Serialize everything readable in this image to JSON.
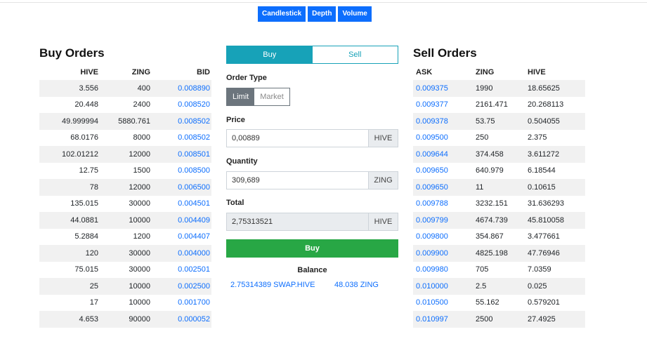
{
  "chart_tabs": [
    "Candlestick",
    "Depth",
    "Volume"
  ],
  "buy_orders": {
    "title": "Buy Orders",
    "columns": [
      "HIVE",
      "ZING",
      "BID"
    ],
    "rows": [
      [
        "3.556",
        "400",
        "0.008890"
      ],
      [
        "20.448",
        "2400",
        "0.008520"
      ],
      [
        "49.999994",
        "5880.761",
        "0.008502"
      ],
      [
        "68.0176",
        "8000",
        "0.008502"
      ],
      [
        "102.01212",
        "12000",
        "0.008501"
      ],
      [
        "12.75",
        "1500",
        "0.008500"
      ],
      [
        "78",
        "12000",
        "0.006500"
      ],
      [
        "135.015",
        "30000",
        "0.004501"
      ],
      [
        "44.0881",
        "10000",
        "0.004409"
      ],
      [
        "5.2884",
        "1200",
        "0.004407"
      ],
      [
        "120",
        "30000",
        "0.004000"
      ],
      [
        "75.015",
        "30000",
        "0.002501"
      ],
      [
        "25",
        "10000",
        "0.002500"
      ],
      [
        "17",
        "10000",
        "0.001700"
      ],
      [
        "4.653",
        "90000",
        "0.000052"
      ]
    ]
  },
  "sell_orders": {
    "title": "Sell Orders",
    "columns": [
      "ASK",
      "ZING",
      "HIVE"
    ],
    "rows": [
      [
        "0.009375",
        "1990",
        "18.65625"
      ],
      [
        "0.009377",
        "2161.471",
        "20.268113"
      ],
      [
        "0.009378",
        "53.75",
        "0.504055"
      ],
      [
        "0.009500",
        "250",
        "2.375"
      ],
      [
        "0.009644",
        "374.458",
        "3.611272"
      ],
      [
        "0.009650",
        "640.979",
        "6.18544"
      ],
      [
        "0.009650",
        "11",
        "0.10615"
      ],
      [
        "0.009788",
        "3232.151",
        "31.636293"
      ],
      [
        "0.009799",
        "4674.739",
        "45.810058"
      ],
      [
        "0.009800",
        "354.867",
        "3.477661"
      ],
      [
        "0.009900",
        "4825.198",
        "47.76946"
      ],
      [
        "0.009980",
        "705",
        "7.0359"
      ],
      [
        "0.010000",
        "2.5",
        "0.025"
      ],
      [
        "0.010500",
        "55.162",
        "0.579201"
      ],
      [
        "0.010997",
        "2500",
        "27.4925"
      ]
    ]
  },
  "order_form": {
    "buy_label": "Buy",
    "sell_label": "Sell",
    "selected_side": "Buy",
    "order_type_label": "Order Type",
    "limit_label": "Limit",
    "market_label": "Market",
    "selected_type": "Limit",
    "price_label": "Price",
    "price_value": "0,00889",
    "price_unit": "HIVE",
    "quantity_label": "Quantity",
    "quantity_value": "309,689",
    "quantity_unit": "ZING",
    "total_label": "Total",
    "total_value": "2,75313521",
    "total_unit": "HIVE",
    "submit_label": "Buy",
    "balance_title": "Balance",
    "balance_hive": "2.75314389 SWAP.HIVE",
    "balance_zing": "48.038 ZING"
  },
  "colors": {
    "link": "#0d6efd",
    "toggle": "#17a2b8",
    "submit": "#28a745",
    "type_active": "#6c757d",
    "stripe": "#f1f1f1"
  }
}
